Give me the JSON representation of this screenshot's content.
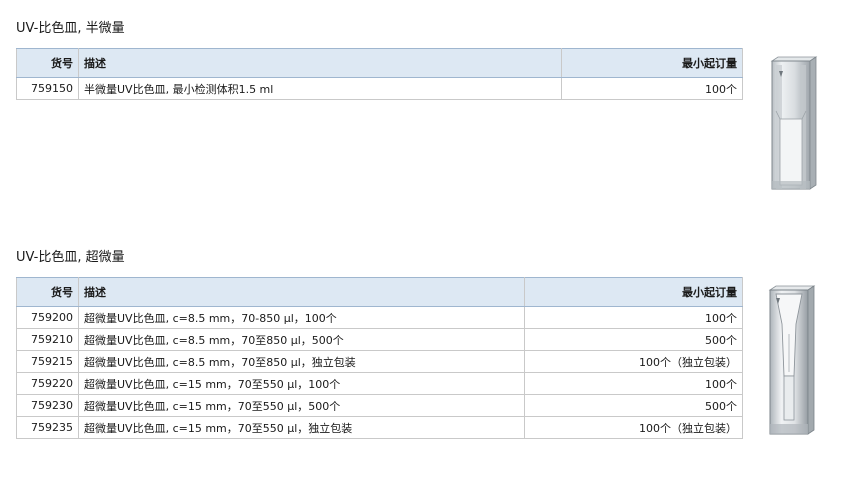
{
  "sections": [
    {
      "title": "UV-比色皿, 半微量",
      "headers": {
        "no": "货号",
        "desc": "描述",
        "moq": "最小起订量"
      },
      "rows": [
        {
          "no": "759150",
          "desc": "半微量UV比色皿, 最小检测体积1.5 ml",
          "moq": "100个"
        }
      ]
    },
    {
      "title": "UV-比色皿, 超微量",
      "headers": {
        "no": "货号",
        "desc": "描述",
        "moq": "最小起订量"
      },
      "rows": [
        {
          "no": "759200",
          "desc": "超微量UV比色皿, c=8.5 mm，70-850 µl，100个",
          "moq": "100个"
        },
        {
          "no": "759210",
          "desc": "超微量UV比色皿, c=8.5 mm，70至850 µl，500个",
          "moq": "500个"
        },
        {
          "no": "759215",
          "desc": "超微量UV比色皿, c=8.5 mm，70至850 µl，独立包装",
          "moq": "100个（独立包装）"
        },
        {
          "no": "759220",
          "desc": "超微量UV比色皿, c=15 mm，70至550 µl，100个",
          "moq": "100个"
        },
        {
          "no": "759230",
          "desc": "超微量UV比色皿, c=15 mm，70至550 µl，500个",
          "moq": "500个"
        },
        {
          "no": "759235",
          "desc": "超微量UV比色皿, c=15 mm，70至550 µl，独立包装",
          "moq": "100个（独立包装）"
        }
      ]
    }
  ],
  "colors": {
    "header_bg": "#dde8f3",
    "border": "#c9c9c9"
  }
}
